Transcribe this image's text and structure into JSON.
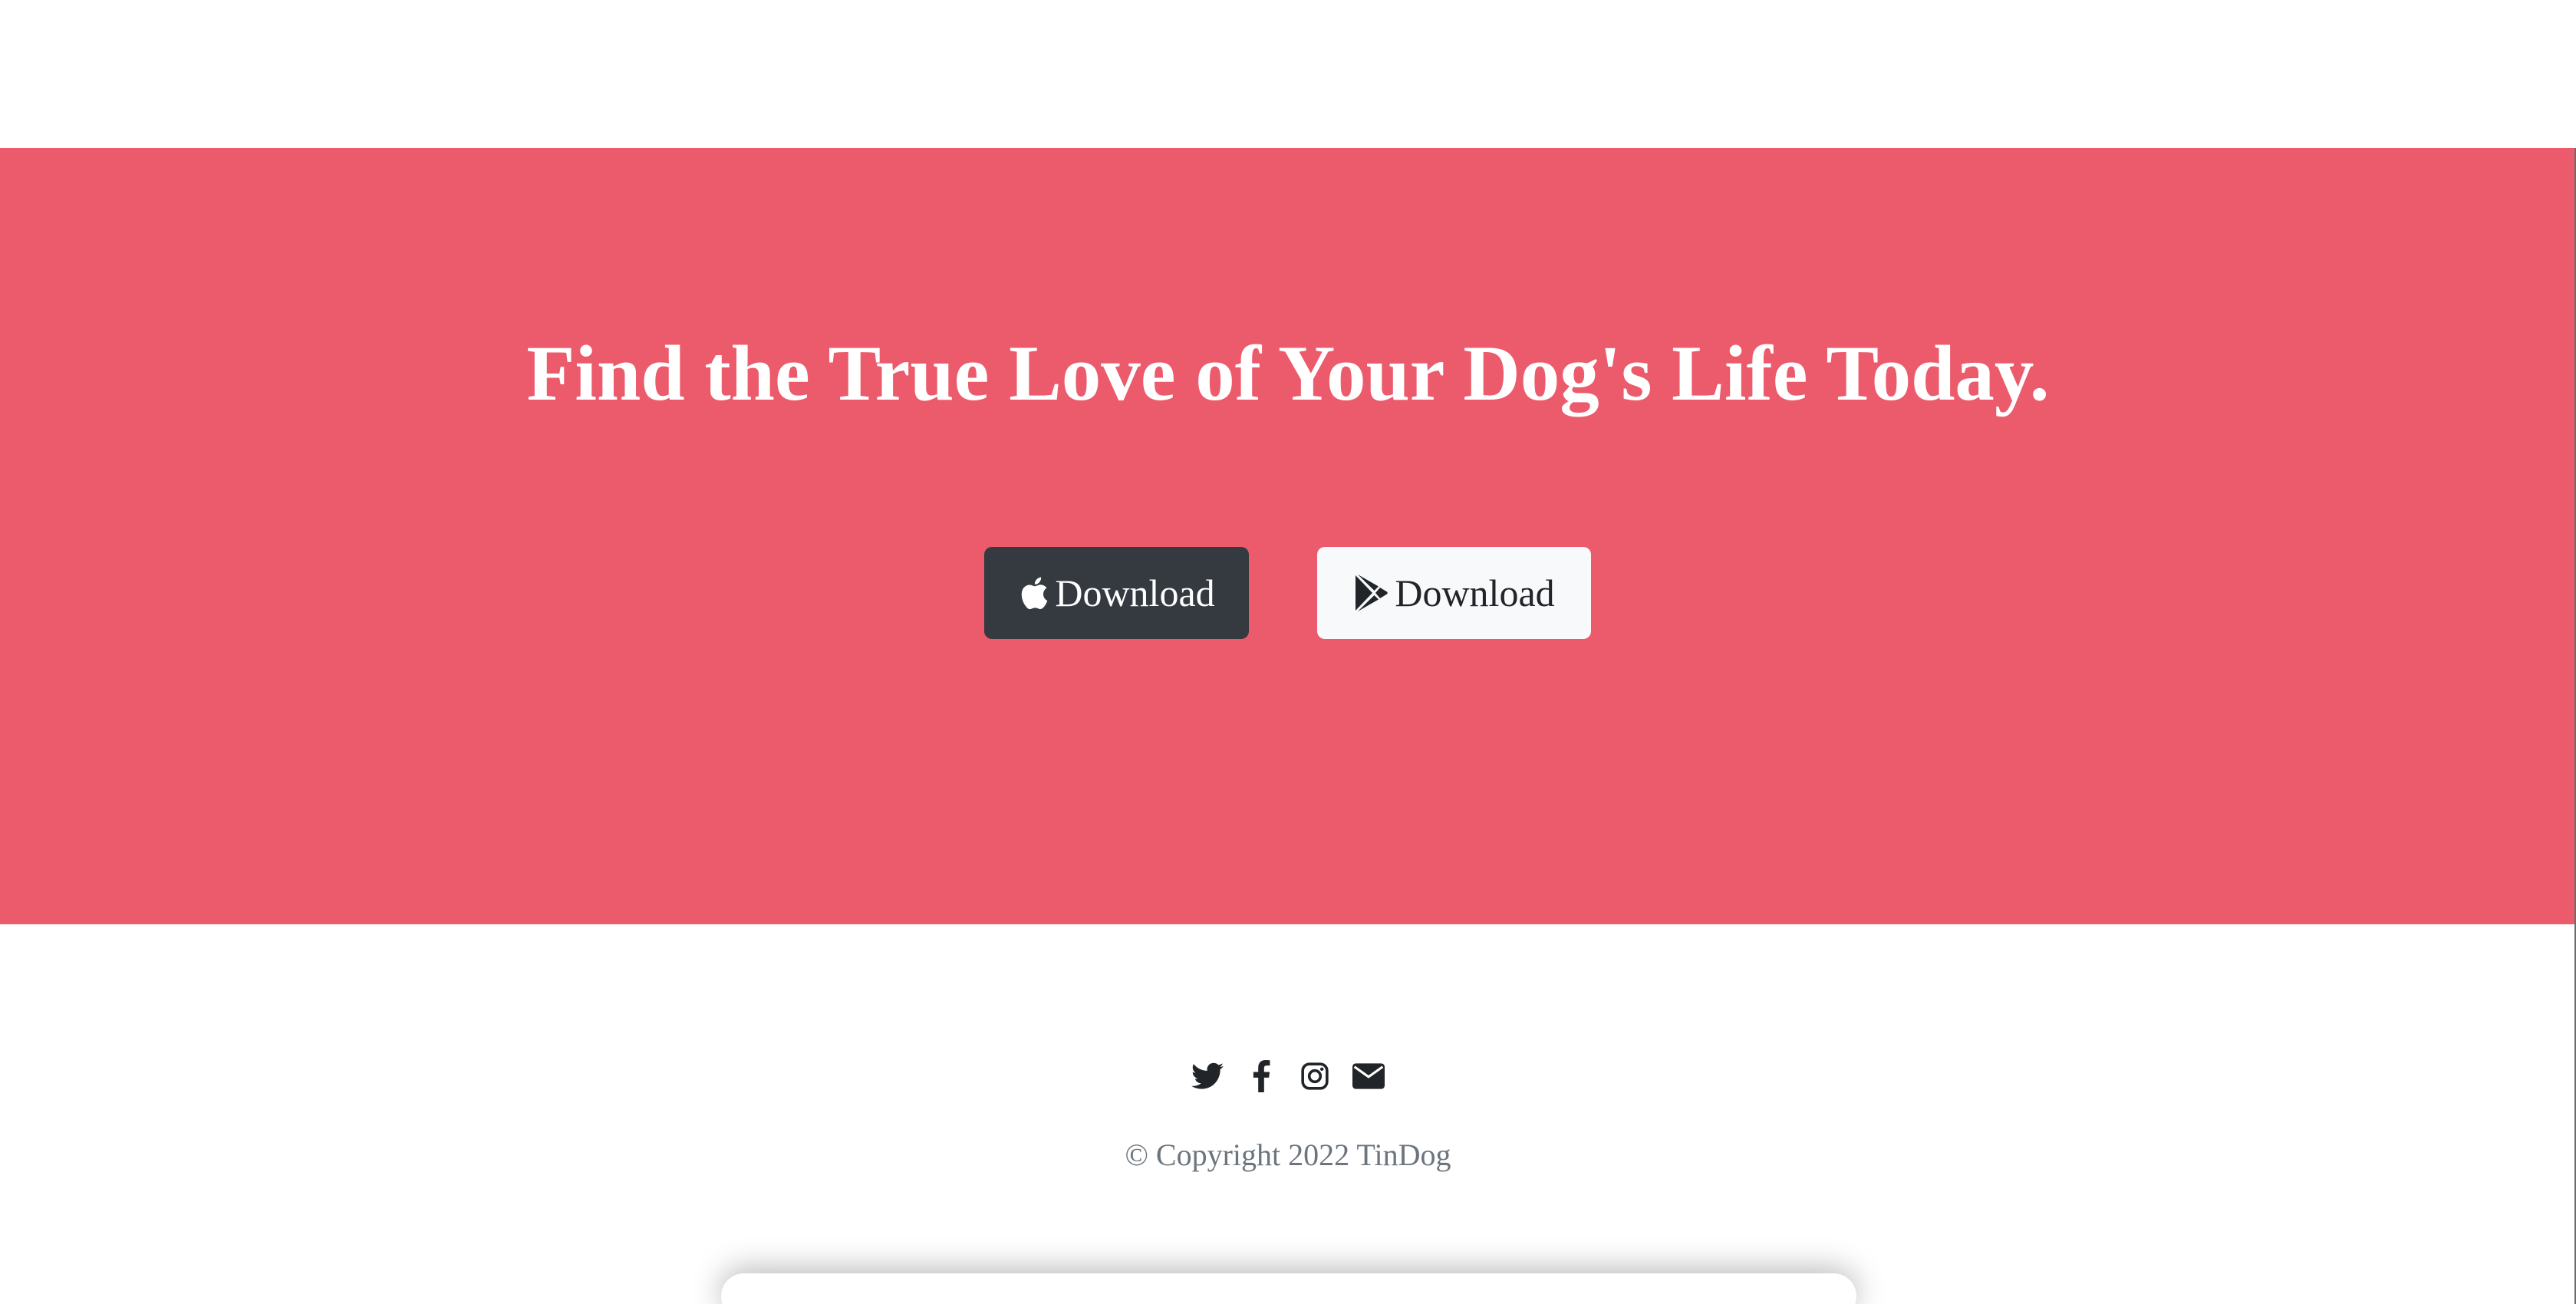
{
  "colors": {
    "cta_background": "#ec5b6c",
    "heading_text": "#ffffff",
    "dark_button": "#343a40",
    "light_button": "#f8f9fa",
    "copyright_text": "#6c757d"
  },
  "cta": {
    "heading": "Find the True Love of Your Dog's Life Today.",
    "buttons": [
      {
        "label": "Download",
        "icon": "apple-icon",
        "style": "dark"
      },
      {
        "label": "Download",
        "icon": "google-play-icon",
        "style": "light"
      }
    ]
  },
  "footer": {
    "social_icons": [
      "twitter-icon",
      "facebook-icon",
      "instagram-icon",
      "envelope-icon"
    ],
    "copyright": "© Copyright 2022 TinDog"
  }
}
